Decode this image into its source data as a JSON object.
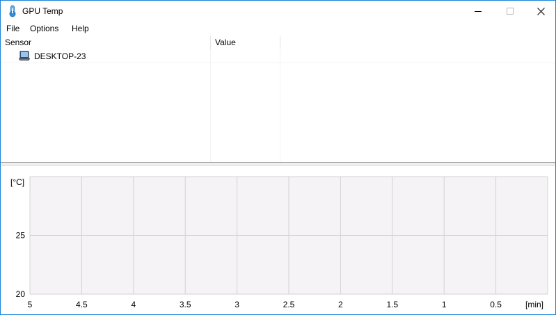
{
  "window": {
    "title": "GPU Temp",
    "icon": "thermometer-icon",
    "controls": [
      "minimize-icon",
      "maximize-icon",
      "close-icon"
    ]
  },
  "menu": {
    "file": "File",
    "options": "Options",
    "help": "Help"
  },
  "tree": {
    "columns": {
      "sensor": "Sensor",
      "value": "Value"
    },
    "rows": [
      {
        "icon": "computer-icon",
        "label": "DESKTOP-23",
        "value": ""
      }
    ]
  },
  "colors": {
    "border": "#1883d7",
    "plot_background": "#f5f3f5",
    "grid": "#d3d3d3"
  },
  "chart_data": {
    "type": "line",
    "ylabel": "[°C]",
    "xlabel": "[min]",
    "ylim": [
      20,
      30
    ],
    "xlim": [
      5,
      0
    ],
    "y_ticks": [
      20,
      25
    ],
    "x_ticks": [
      "5",
      "4.5",
      "4",
      "3.5",
      "3",
      "2.5",
      "2",
      "1.5",
      "1",
      "0.5"
    ],
    "grid": true,
    "series": []
  }
}
